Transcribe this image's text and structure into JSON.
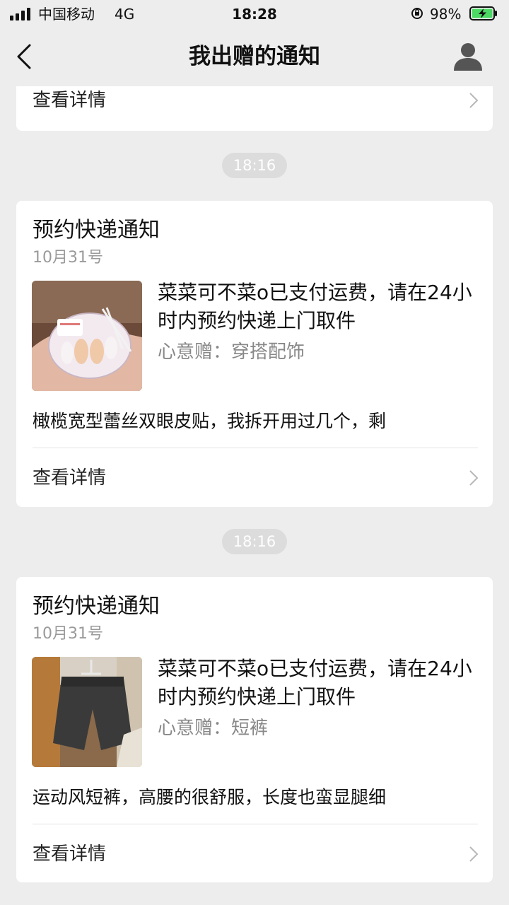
{
  "status_bar": {
    "carrier": "中国移动",
    "network": "4G",
    "time": "18:28",
    "battery_percent": "98%",
    "signal_bars": 4,
    "battery_charging": true
  },
  "nav": {
    "title": "我出赠的通知",
    "back_icon": "chevron-left-icon",
    "profile_icon": "person-icon"
  },
  "top_card": {
    "detail_label": "查看详情"
  },
  "notifications": [
    {
      "time_label": "18:16",
      "title": "预约快递通知",
      "date": "10月31号",
      "message": "菜菜可不菜o已支付运费，请在24小时内预约快递上门取件",
      "category_label": "心意赠：",
      "category_value": "穿搭配饰",
      "description": "橄榄宽型蕾丝双眼皮贴，我拆开用过几个，剩",
      "detail_label": "查看详情"
    },
    {
      "time_label": "18:16",
      "title": "预约快递通知",
      "date": "10月31号",
      "message": "菜菜可不菜o已支付运费，请在24小时内预约快递上门取件",
      "category_label": "心意赠：",
      "category_value": "短裤",
      "description": "运动风短裤，高腰的很舒服，长度也蛮显腿细",
      "detail_label": "查看详情"
    }
  ],
  "colors": {
    "background": "#ededed",
    "card": "#ffffff",
    "pill": "#dcdcdc",
    "battery_fill": "#4cd964"
  }
}
